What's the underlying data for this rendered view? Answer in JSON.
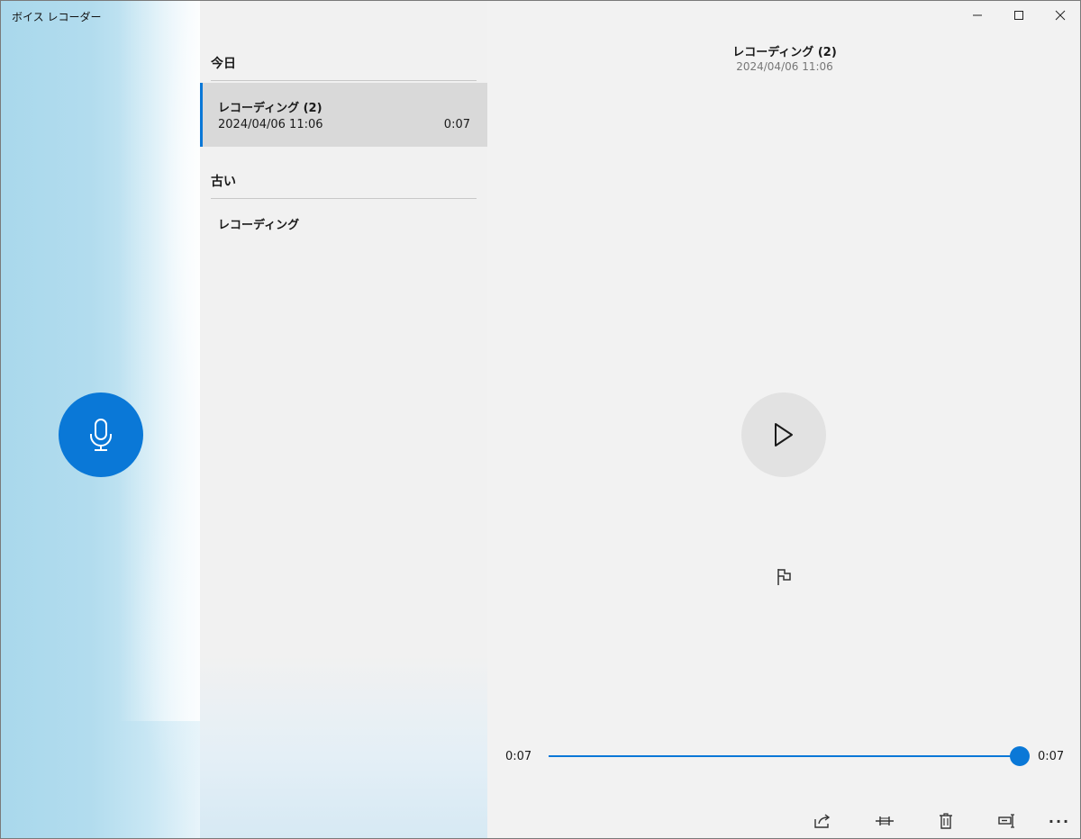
{
  "window": {
    "title": "ボイス レコーダー"
  },
  "recorder": {
    "record_icon": "microphone-icon"
  },
  "list": {
    "groups": [
      {
        "header": "今日",
        "items": [
          {
            "name": "レコーディング (2)",
            "date": "2024/04/06 11:06",
            "duration": "0:07",
            "selected": true
          }
        ]
      },
      {
        "header": "古い",
        "items": [
          {
            "name": "レコーディング",
            "date": "",
            "duration": "",
            "selected": false
          }
        ]
      }
    ]
  },
  "detail": {
    "title": "レコーディング (2)",
    "date": "2024/04/06 11:06",
    "play_icon": "play-icon",
    "marker_icon": "flag-icon",
    "position_time": "0:07",
    "total_time": "0:07",
    "progress": 1.0
  },
  "toolbar": {
    "items": [
      "share-icon",
      "trim-icon",
      "delete-icon",
      "rename-icon",
      "more-icon"
    ],
    "more_label": "···"
  },
  "colors": {
    "accent": "#0a78d7",
    "left_pane": "#b2dcee",
    "background": "#f2f2f2",
    "selected_item": "#d9d9d9"
  }
}
